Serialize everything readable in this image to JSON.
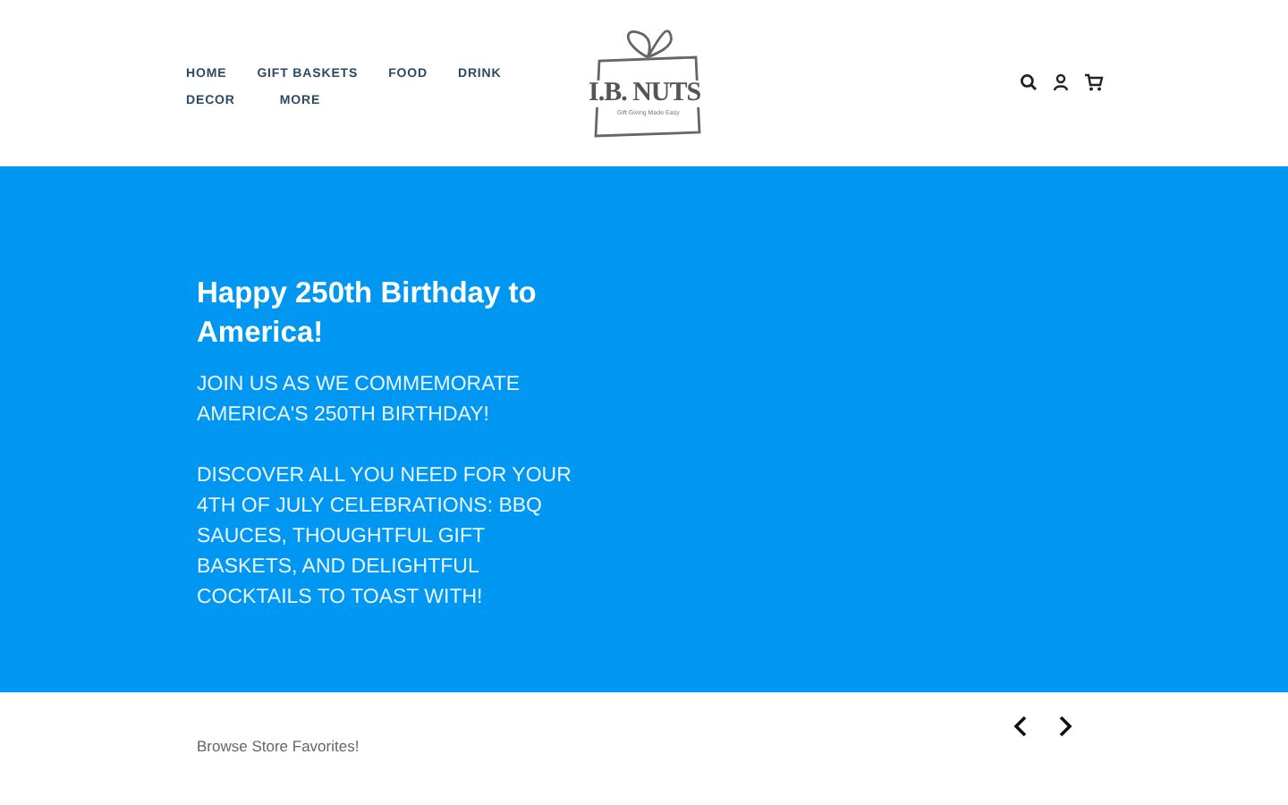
{
  "nav": [
    {
      "label": "HOME"
    },
    {
      "label": "GIFT BASKETS"
    },
    {
      "label": "FOOD"
    },
    {
      "label": "DRINK"
    },
    {
      "label": "DECOR"
    },
    {
      "label": "MORE"
    }
  ],
  "logo": {
    "name": "I.B. NUTS",
    "tagline": "Gift Giving Made Easy"
  },
  "hero": {
    "title": "Happy 250th Birthday to America!",
    "paragraphs": [
      "JOIN US AS WE COMMEMORATE AMERICA'S 250TH BIRTHDAY!",
      "DISCOVER ALL YOU NEED FOR YOUR 4TH OF JULY CELEBRATIONS: BBQ SAUCES, THOUGHTFUL GIFT BASKETS, AND DELIGHTFUL COCKTAILS TO TOAST WITH!"
    ]
  },
  "favorites": {
    "label": "Browse Store Favorites!"
  }
}
